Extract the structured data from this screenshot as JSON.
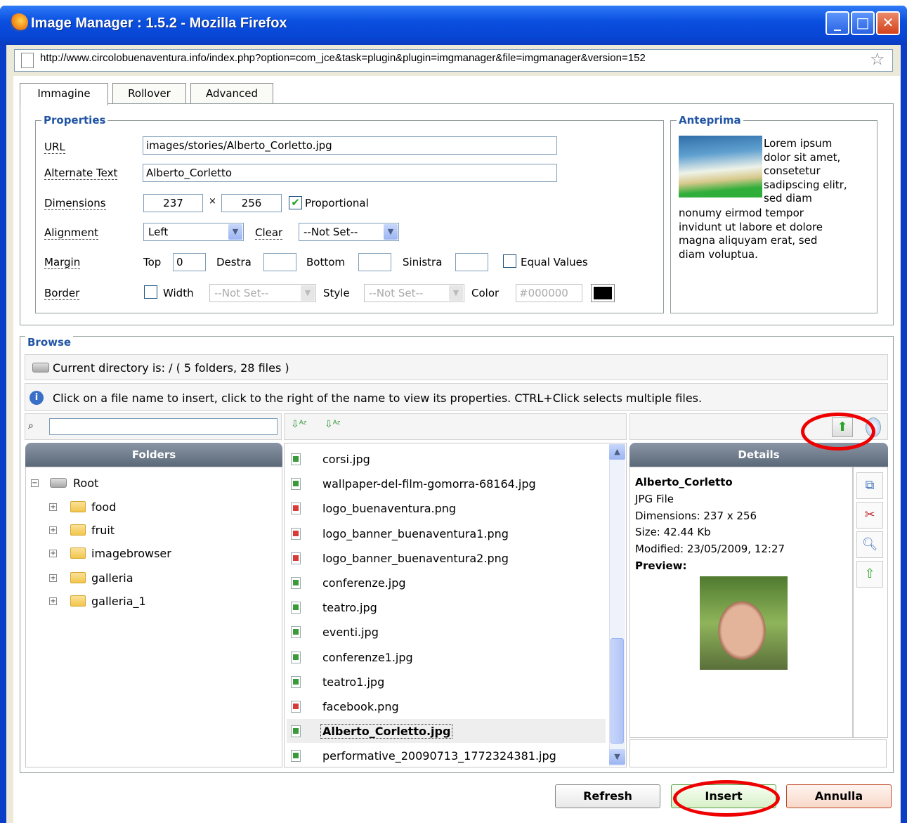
{
  "window": {
    "title": "Image Manager : 1.5.2 - Mozilla Firefox"
  },
  "address_bar": {
    "url": "http://www.circolobuenaventura.info/index.php?option=com_jce&task=plugin&plugin=imgmanager&file=imgmanager&version=152"
  },
  "tabs": [
    "Immagine",
    "Rollover",
    "Advanced"
  ],
  "properties": {
    "legend": "Properties",
    "url_label": "URL",
    "url_value": "images/stories/Alberto_Corletto.jpg",
    "alt_label": "Alternate Text",
    "alt_value": "Alberto_Corletto",
    "dimensions_label": "Dimensions",
    "width": "237",
    "times": "×",
    "height": "256",
    "proportional_label": "Proportional",
    "alignment_label": "Alignment",
    "alignment_value": "Left",
    "clear_label": "Clear",
    "clear_value": "--Not Set--",
    "margin_label": "Margin",
    "top_label": "Top",
    "top_value": "0",
    "right_label": "Destra",
    "bottom_label": "Bottom",
    "left_label": "Sinistra",
    "equal_values_label": "Equal Values",
    "border_label": "Border",
    "width_label": "Width",
    "width_select": "--Not Set--",
    "style_label": "Style",
    "style_select": "--Not Set--",
    "color_label": "Color",
    "color_value": "#000000"
  },
  "preview": {
    "legend": "Anteprima",
    "text_lines": [
      "Lorem ipsum",
      "dolor sit amet,",
      "consetetur",
      "sadipscing elitr,",
      "sed diam",
      "nonumy eirmod tempor",
      "invidunt ut labore et dolore",
      "magna aliquyam erat, sed",
      "diam voluptua."
    ]
  },
  "browse": {
    "legend": "Browse",
    "current_dir": "Current directory is: / ( 5 folders, 28 files )",
    "info": "Click on a file name to insert, click to the right of the name to view its properties. CTRL+Click selects multiple files.",
    "folders_title": "Folders",
    "root_label": "Root",
    "folders": [
      "food",
      "fruit",
      "imagebrowser",
      "galleria",
      "galleria_1"
    ],
    "files": [
      {
        "name": "corsi.jpg",
        "type": "jpg"
      },
      {
        "name": "wallpaper-del-film-gomorra-68164.jpg",
        "type": "jpg"
      },
      {
        "name": "logo_buenaventura.png",
        "type": "png"
      },
      {
        "name": "logo_banner_buenaventura1.png",
        "type": "png"
      },
      {
        "name": "logo_banner_buenaventura2.png",
        "type": "png"
      },
      {
        "name": "conferenze.jpg",
        "type": "jpg"
      },
      {
        "name": "teatro.jpg",
        "type": "jpg"
      },
      {
        "name": "eventi.jpg",
        "type": "jpg"
      },
      {
        "name": "conferenze1.jpg",
        "type": "jpg"
      },
      {
        "name": "teatro1.jpg",
        "type": "jpg"
      },
      {
        "name": "facebook.png",
        "type": "png"
      },
      {
        "name": "Alberto_Corletto.jpg",
        "type": "jpg",
        "selected": true
      },
      {
        "name": "performative_20090713_1772324381.jpg",
        "type": "jpg"
      }
    ],
    "details_title": "Details",
    "details": {
      "name": "Alberto_Corletto",
      "type": "JPG File",
      "dimensions": "Dimensions: 237 x 256",
      "size": "Size: 42.44 Kb",
      "modified": "Modified: 23/05/2009, 12:27",
      "preview_label": "Preview:"
    }
  },
  "buttons": {
    "refresh": "Refresh",
    "insert": "Insert",
    "cancel": "Annulla"
  },
  "colors": {
    "title_bar": "#0a4fe0",
    "legend": "#2255a4",
    "annotation_ring": "#ee0000"
  }
}
